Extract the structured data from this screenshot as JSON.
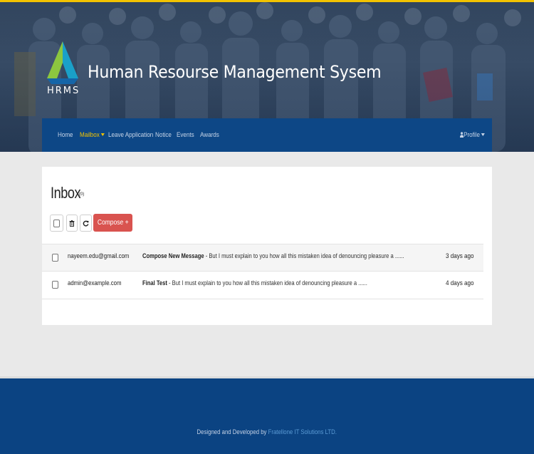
{
  "brand": {
    "logo_text": "HRMS",
    "site_title": "Human Resourse Management Sysem"
  },
  "colors": {
    "accent": "#f2c300",
    "nav_bg": "#0d4786",
    "compose": "#d9534f",
    "footer_bg": "#0b4382"
  },
  "nav": {
    "items": [
      {
        "label": "Home"
      },
      {
        "label": "Mailbox",
        "active": true,
        "dropdown": true
      },
      {
        "label": "Leave Application"
      },
      {
        "label": "Notice"
      },
      {
        "label": "Events"
      },
      {
        "label": "Awards"
      }
    ],
    "profile_label": "Profile",
    "profile_icon": "user-icon"
  },
  "inbox": {
    "title": "Inbox",
    "count": "(0)",
    "toolbar": {
      "select_all_icon": "checkbox-icon",
      "delete_icon": "trash-icon",
      "refresh_icon": "refresh-icon",
      "compose_label": "Compose +"
    },
    "messages": [
      {
        "from": "nayeem.edu@gmail.com",
        "subject": "Compose New Message",
        "separator": " - ",
        "preview": "But I must explain to you how all this mistaken idea of denouncing pleasure a ......",
        "date": "3 days ago"
      },
      {
        "from": "admin@example.com",
        "subject": "Final Test",
        "separator": " - ",
        "preview": "But I must explain to you how all this mistaken idea of denouncing pleasure a ......",
        "date": "4 days ago"
      }
    ]
  },
  "footer": {
    "text": "Designed and Developed by ",
    "link": "Fratellone IT Solutions LTD."
  }
}
